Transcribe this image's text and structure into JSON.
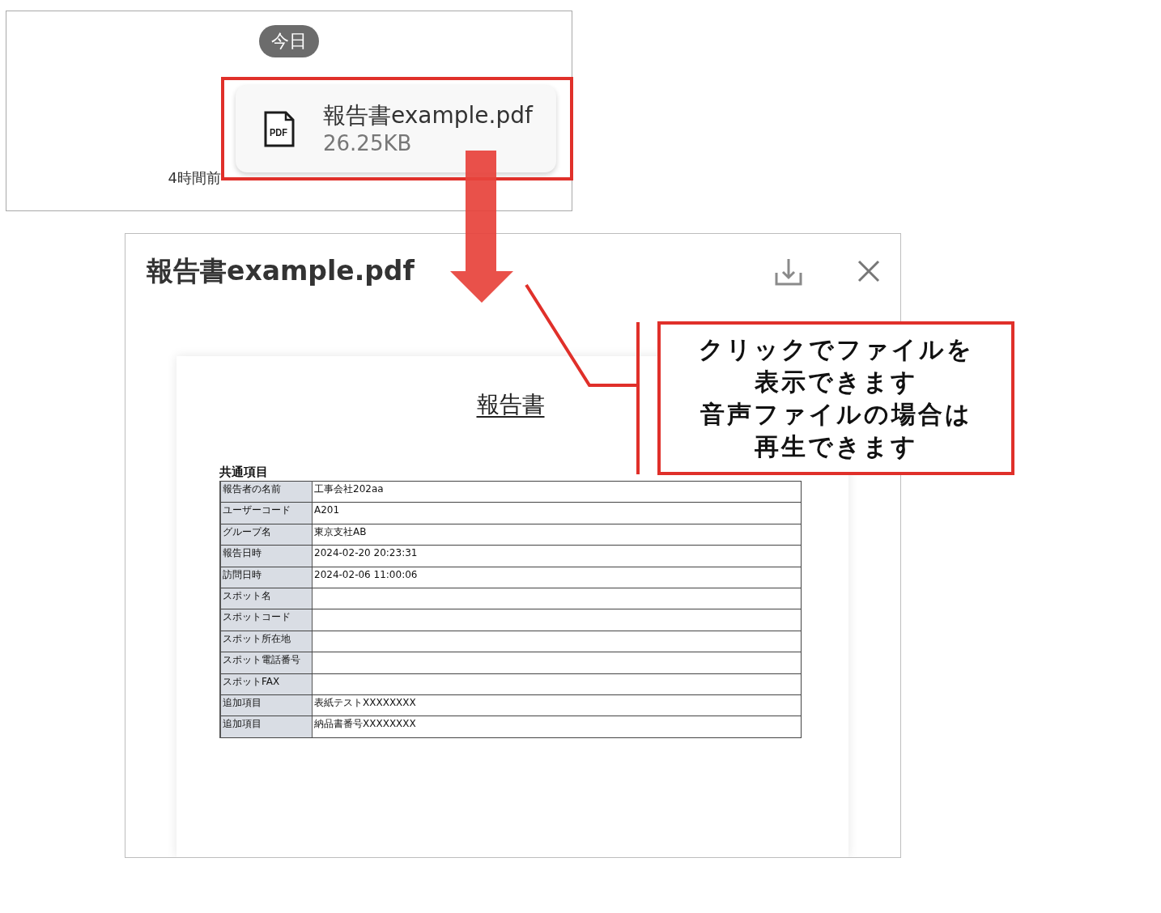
{
  "chat": {
    "date_chip": "今日",
    "attachment": {
      "icon_label": "PDF",
      "name": "報告書example.pdf",
      "size": "26.25KB"
    },
    "time": "4時間前"
  },
  "viewer": {
    "title": "報告書example.pdf",
    "document": {
      "heading": "報告書",
      "section_title": "共通項目",
      "rows": [
        {
          "label": "報告者の名前",
          "value": "工事会社202aa"
        },
        {
          "label": "ユーザーコード",
          "value": "A201"
        },
        {
          "label": "グループ名",
          "value": "東京支社AB"
        },
        {
          "label": "報告日時",
          "value": "2024-02-20 20:23:31"
        },
        {
          "label": "訪問日時",
          "value": "2024-02-06 11:00:06"
        },
        {
          "label": "スポット名"
        },
        {
          "label": "スポットコード"
        },
        {
          "label": "スポット所在地"
        },
        {
          "label": "スポット電話番号"
        },
        {
          "label": "スポットFAX"
        },
        {
          "label": "追加項目",
          "value": "表紙テストXXXXXXXX"
        },
        {
          "label": "追加項目",
          "value": "納品書番号XXXXXXXX"
        }
      ]
    }
  },
  "callout": {
    "lines": [
      "クリックでファイルを",
      "表示できます",
      "音声ファイルの場合は",
      "再生できます"
    ]
  }
}
